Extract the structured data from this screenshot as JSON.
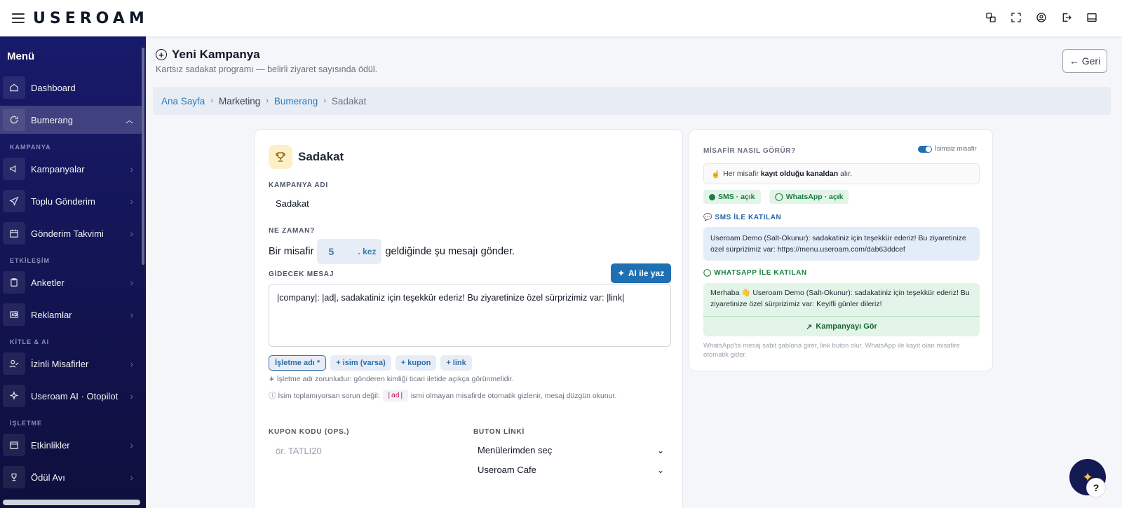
{
  "app": {
    "logo": "USEROAM"
  },
  "sidebar": {
    "title": "Menü",
    "items_top": [
      {
        "label": "Dashboard"
      },
      {
        "label": "Bumerang",
        "chevron": "^"
      }
    ],
    "sections": [
      {
        "title": "KAMPANYA",
        "items": [
          {
            "label": "Kampanyalar"
          },
          {
            "label": "Toplu Gönderim"
          },
          {
            "label": "Gönderim Takvimi"
          }
        ]
      },
      {
        "title": "ETKİLEŞİM",
        "items": [
          {
            "label": "Anketler"
          },
          {
            "label": "Reklamlar"
          }
        ]
      },
      {
        "title": "KİTLE & AI",
        "items": [
          {
            "label": "İzinli Misafirler"
          },
          {
            "label": "Useroam AI · Otopilot"
          }
        ]
      },
      {
        "title": "İŞLETME",
        "items": [
          {
            "label": "Etkinlikler"
          },
          {
            "label": "Ödül Avı"
          }
        ]
      }
    ],
    "chevron": "›"
  },
  "page": {
    "title": "Yeni Kampanya",
    "plus": "+",
    "subtitle": "Kartsız sadakat programı — belirli ziyaret sayısında ödül.",
    "back_label": "← Geri"
  },
  "breadcrumb": {
    "items": [
      "Ana Sayfa",
      "Marketing",
      "Bumerang",
      "Sadakat"
    ],
    "sep": "›"
  },
  "form": {
    "title": "Sadakat",
    "name_label": "KAMPANYA ADI",
    "name_value": "Sadakat",
    "when_label": "NE ZAMAN?",
    "when_prefix": "Bir misafir",
    "when_count": "5",
    "when_unit": ". kez",
    "when_suffix": "geldiğinde şu mesajı gönder.",
    "message_label": "GİDECEK MESAJ",
    "ai_button": "AI ile yaz",
    "message_value": "|company|: |ad|, sadakatiniz için teşekkür ederiz! Bu ziyaretinize özel sürprizimiz var: |link|",
    "chips": [
      "İşletme adı *",
      "+ isim (varsa)",
      "+ kupon",
      "+ link"
    ],
    "note1": "∗ İşletme adı zorunludur: gönderen kimliği ticari iletide açıkça görünmelidir.",
    "note2_prefix": "ⓘ İsim toplamıyorsan sorun değil:",
    "note2_code": "|ad|",
    "note2_suffix": "ismi olmayan misafirde otomatik gizlenir, mesaj düzgün okunur.",
    "coupon_label": "KUPON KODU (OPS.)",
    "coupon_placeholder": "ör. TATLI20",
    "button_link_label": "BUTON LİNKİ",
    "button_link_select": "Menülerimden seç",
    "button_link_menu": "Useroam Cafe",
    "select_chevron": "⌄"
  },
  "preview": {
    "title": "MİSAFİR NASIL GÖRÜR?",
    "toggle_label": "İsimsiz misafir",
    "toggle_on": true,
    "info_prefix": "Her misafir",
    "info_bold": "kayıt olduğu kanaldan",
    "info_suffix": "alır.",
    "sms_pill": "SMS · açık",
    "wa_pill": "WhatsApp · açık",
    "sms_label": "SMS İLE KATILAN",
    "sms_text": "Useroam Demo (Salt-Okunur): sadakatiniz için teşekkür ederiz! Bu ziyaretinize özel sürprizimiz var: https://menu.useroam.com/dab63ddcef",
    "wa_label": "WHATSAPP İLE KATILAN",
    "wa_text": "Merhaba 👋 Useroam Demo (Salt-Okunur): sadakatiniz için teşekkür ederiz! Bu ziyaretinize özel sürprizimiz var: Keyifli günler dileriz!",
    "wa_button": "Kampanyayı Gör",
    "footer": "WhatsApp'ta mesaj sabit şablona girer, link buton olur. WhatsApp ile kayıt olan misafire otomatik gider."
  },
  "fab": {
    "help": "?",
    "sparkle": "✦"
  },
  "colors": {
    "accent": "#1f6fb3",
    "sidebar": "#181a6b",
    "success": "#15803d"
  }
}
